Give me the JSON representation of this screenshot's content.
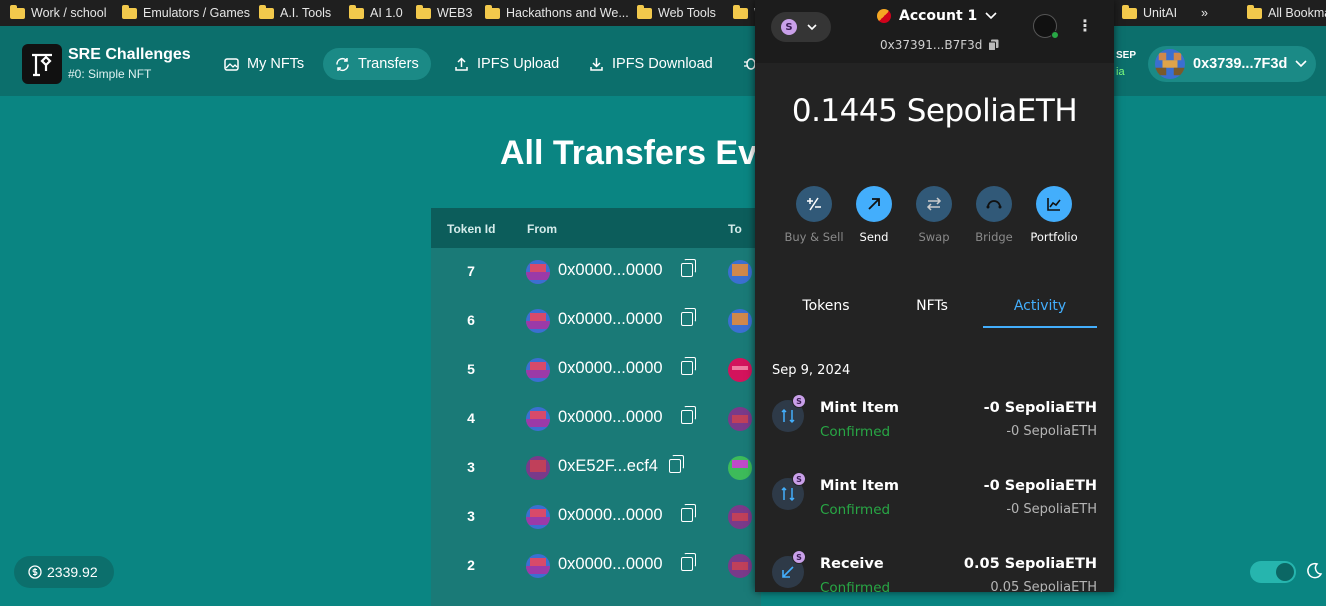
{
  "bookmarks": [
    {
      "label": "Work / school"
    },
    {
      "label": "Emulators / Games"
    },
    {
      "label": "A.I. Tools"
    },
    {
      "label": "AI 1.0"
    },
    {
      "label": "WEB3"
    },
    {
      "label": "Hackathons and We..."
    },
    {
      "label": "Web Tools"
    },
    {
      "label": "W"
    },
    {
      "label": "UnitAI"
    },
    {
      "label": "All Bookma"
    }
  ],
  "bookmarks_overflow": "»",
  "app": {
    "brand_title": "SRE Challenges",
    "brand_subtitle": "#0: Simple NFT",
    "nav": [
      {
        "label": "My NFTs",
        "icon": "image-icon"
      },
      {
        "label": "Transfers",
        "icon": "refresh-icon"
      },
      {
        "label": "IPFS Upload",
        "icon": "upload-icon"
      },
      {
        "label": "IPFS Download",
        "icon": "download-icon"
      }
    ],
    "network_short": "SEP",
    "network_partial": "ia",
    "account_address": "0x3739...7F3d",
    "page_title": "All Transfers Ev",
    "table": {
      "headers": {
        "token_id": "Token Id",
        "from": "From",
        "to": "To"
      },
      "rows": [
        {
          "token_id": "7",
          "from": "0x0000...0000"
        },
        {
          "token_id": "6",
          "from": "0x0000...0000"
        },
        {
          "token_id": "5",
          "from": "0x0000...0000"
        },
        {
          "token_id": "4",
          "from": "0x0000...0000"
        },
        {
          "token_id": "3",
          "from": "0xE52F...ecf4"
        },
        {
          "token_id": "3",
          "from": "0x0000...0000"
        },
        {
          "token_id": "2",
          "from": "0x0000...0000"
        }
      ]
    },
    "eth_price": "2339.92"
  },
  "wallet": {
    "network_badge": "S",
    "account_name": "Account 1",
    "account_address": "0x37391...B7F3d",
    "balance": "0.1445",
    "currency": "SepoliaETH",
    "actions": [
      {
        "label": "Buy & Sell",
        "icon": "plus-minus-icon",
        "enabled": false
      },
      {
        "label": "Send",
        "icon": "arrow-up-right-icon",
        "enabled": true
      },
      {
        "label": "Swap",
        "icon": "swap-icon",
        "enabled": false
      },
      {
        "label": "Bridge",
        "icon": "bridge-icon",
        "enabled": false
      },
      {
        "label": "Portfolio",
        "icon": "chart-icon",
        "enabled": true
      }
    ],
    "tabs": [
      {
        "label": "Tokens",
        "active": false
      },
      {
        "label": "NFTs",
        "active": false
      },
      {
        "label": "Activity",
        "active": true
      }
    ],
    "activity_date": "Sep 9, 2024",
    "activity": [
      {
        "title": "Mint Item",
        "status": "Confirmed",
        "amount": "-0 SepoliaETH",
        "amount_fiat": "-0 SepoliaETH",
        "icon": "contract-interaction-icon"
      },
      {
        "title": "Mint Item",
        "status": "Confirmed",
        "amount": "-0 SepoliaETH",
        "amount_fiat": "-0 SepoliaETH",
        "icon": "contract-interaction-icon"
      },
      {
        "title": "Receive",
        "status": "Confirmed",
        "amount": "0.05 SepoliaETH",
        "amount_fiat": "0.05 SepoliaETH",
        "icon": "receive-arrow-icon"
      }
    ]
  },
  "colors": {
    "page_bg": "#0a8582",
    "header_bg": "#0c6f6c",
    "wallet_bg": "#232323",
    "accent_blue": "#43aefc",
    "confirmed_green": "#28a745"
  }
}
